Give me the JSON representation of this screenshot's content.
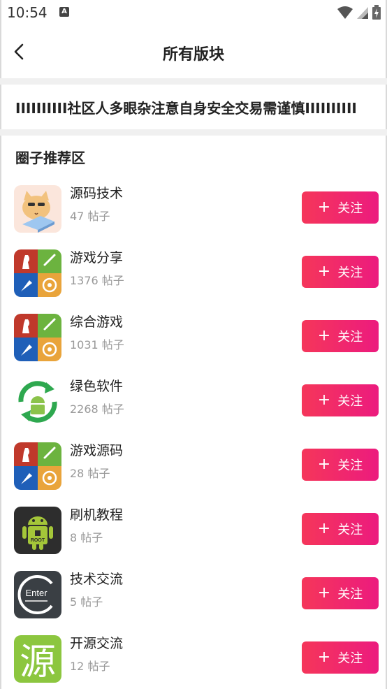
{
  "status_bar": {
    "time": "10:54",
    "notification_icon": "a-icon",
    "icons": [
      "wifi-icon",
      "signal-icon",
      "battery-icon"
    ]
  },
  "header": {
    "back_icon": "back-arrow-icon",
    "title": "所有版块"
  },
  "notice": {
    "text": "IIIIIIIIII社区人多眼杂注意自身安全交易需谨慎IIIIIIIIII"
  },
  "section": {
    "title": "圈子推荐区",
    "follow_label": "关注",
    "follow_icon": "plus-icon",
    "items": [
      {
        "name": "源码技术",
        "count": "47 帖子",
        "icon": "cat-laptop-icon"
      },
      {
        "name": "游戏分享",
        "count": "1376 帖子",
        "icon": "game-center-icon"
      },
      {
        "name": "综合游戏",
        "count": "1031 帖子",
        "icon": "game-center-icon"
      },
      {
        "name": "绿色软件",
        "count": "2268 帖子",
        "icon": "android-recycle-icon"
      },
      {
        "name": "游戏源码",
        "count": "28 帖子",
        "icon": "game-center-icon"
      },
      {
        "name": "刷机教程",
        "count": "8 帖子",
        "icon": "android-root-icon"
      },
      {
        "name": "技术交流",
        "count": "5 帖子",
        "icon": "enter-icon"
      },
      {
        "name": "开源交流",
        "count": "12 帖子",
        "icon": "yuan-character-icon"
      }
    ]
  },
  "colors": {
    "button_gradient_start": "#f5365a",
    "button_gradient_end": "#ec1b7e",
    "muted_text": "#999999",
    "separator": "#f0f0f0"
  }
}
